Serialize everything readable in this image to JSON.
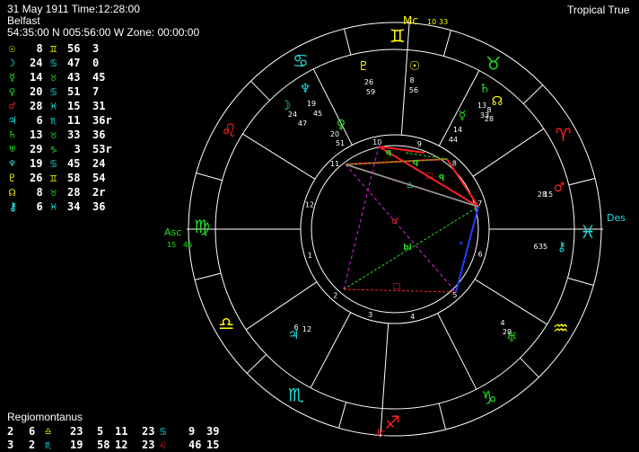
{
  "header": {
    "datetime": "31 May 1911 Time:12:28:00",
    "place": "Belfast",
    "coords": "54:35:00 N 005:56:00 W Zone: 00:00:00",
    "zodiac_mode": "Tropical True"
  },
  "colors": {
    "fire": "#ff2020",
    "earth": "#20e020",
    "air": "#ffff00",
    "water": "#20e0e0",
    "planet": "#ffff00",
    "house_cusp": "#ffffff",
    "asc": "#20e020",
    "mc": "#ffff00",
    "ic": "#ff2020",
    "des": "#20e0e0"
  },
  "planets": [
    {
      "glyph": "☉",
      "color": "#ffff00",
      "deg": "8",
      "sign": "♊",
      "sign_color": "#ffff00",
      "min": "56",
      "sec": "3"
    },
    {
      "glyph": "☽",
      "color": "#20e0e0",
      "deg": "24",
      "sign": "♋",
      "sign_color": "#20e0e0",
      "min": "47",
      "sec": "0"
    },
    {
      "glyph": "☿",
      "color": "#20e020",
      "deg": "14",
      "sign": "♉",
      "sign_color": "#20e020",
      "min": "43",
      "sec": "45"
    },
    {
      "glyph": "♀",
      "color": "#20e020",
      "deg": "20",
      "sign": "♋",
      "sign_color": "#20e0e0",
      "min": "51",
      "sec": "7"
    },
    {
      "glyph": "♂",
      "color": "#ff2020",
      "deg": "28",
      "sign": "♓",
      "sign_color": "#20e0e0",
      "min": "15",
      "sec": "31"
    },
    {
      "glyph": "♃",
      "color": "#20e0e0",
      "deg": "6",
      "sign": "♏",
      "sign_color": "#20e0e0",
      "min": "11",
      "sec": "36r"
    },
    {
      "glyph": "♄",
      "color": "#20e020",
      "deg": "13",
      "sign": "♉",
      "sign_color": "#20e020",
      "min": "33",
      "sec": "36"
    },
    {
      "glyph": "♅",
      "color": "#20e020",
      "deg": "29",
      "sign": "♑",
      "sign_color": "#20e020",
      "min": "3",
      "sec": "53r"
    },
    {
      "glyph": "♆",
      "color": "#20e0e0",
      "deg": "19",
      "sign": "♋",
      "sign_color": "#20e0e0",
      "min": "45",
      "sec": "24"
    },
    {
      "glyph": "♇",
      "color": "#ffff00",
      "deg": "26",
      "sign": "♊",
      "sign_color": "#ffff00",
      "min": "58",
      "sec": "54"
    },
    {
      "glyph": "☊",
      "color": "#ffff00",
      "deg": "8",
      "sign": "♉",
      "sign_color": "#20e020",
      "min": "28",
      "sec": "2r"
    },
    {
      "glyph": "⚷",
      "color": "#20e0e0",
      "deg": "6",
      "sign": "♓",
      "sign_color": "#20e0e0",
      "min": "34",
      "sec": "36"
    }
  ],
  "house_system": "Regiomontanus",
  "houses": [
    [
      {
        "num": "2",
        "deg": "6",
        "sign": "♎",
        "sign_color": "#ffff00",
        "min": "23"
      },
      {
        "num": "5",
        "deg": "11",
        "sign": "",
        "sign_color": "#ffffff",
        "min": "23"
      },
      {
        "num": "",
        "deg": "",
        "sign": "♋",
        "sign_color": "#20e0e0",
        "min": ""
      },
      {
        "num": "9",
        "deg": "",
        "sign": "",
        "sign_color": "#ffffff",
        "min": "39"
      }
    ],
    [
      {
        "num": "3",
        "deg": "2",
        "sign": "♏",
        "sign_color": "#20e0e0",
        "min": "19"
      },
      {
        "num": "58",
        "deg": "12",
        "sign": "",
        "sign_color": "#ffffff",
        "min": "23"
      },
      {
        "num": "",
        "deg": "",
        "sign": "♌",
        "sign_color": "#ff2020",
        "min": ""
      },
      {
        "num": "46",
        "deg": "",
        "sign": "",
        "sign_color": "#ffffff",
        "min": "15"
      }
    ]
  ],
  "wheel": {
    "angles": {
      "asc_label": "Asc",
      "asc_deg": "15",
      "asc_min": "46",
      "mc_label": "Mc",
      "mc_deg": "10",
      "mc_min": "33",
      "des_label": "Des",
      "ic_label": "Ic"
    },
    "signs": [
      {
        "glyph": "♊",
        "color": "#ffff00"
      },
      {
        "glyph": "♉",
        "color": "#20e020"
      },
      {
        "glyph": "♈",
        "color": "#ff2020"
      },
      {
        "glyph": "♓",
        "color": "#20e0e0"
      },
      {
        "glyph": "♒",
        "color": "#ffff00"
      },
      {
        "glyph": "♑",
        "color": "#20e020"
      },
      {
        "glyph": "♐",
        "color": "#ff2020"
      },
      {
        "glyph": "♏",
        "color": "#20e0e0"
      },
      {
        "glyph": "♎",
        "color": "#ffff00"
      },
      {
        "glyph": "♍",
        "color": "#20e020"
      },
      {
        "glyph": "♌",
        "color": "#ff2020"
      },
      {
        "glyph": "♋",
        "color": "#20e0e0"
      }
    ],
    "house_numbers": [
      "1",
      "2",
      "3",
      "4",
      "5",
      "6",
      "7",
      "8",
      "9",
      "10",
      "11",
      "12"
    ],
    "wheel_planets": [
      {
        "glyph": "♇",
        "color": "#ffff00",
        "deg": "26",
        "min": "59"
      },
      {
        "glyph": "☉",
        "color": "#ffff00",
        "deg": "8",
        "min": "56"
      },
      {
        "glyph": "♆",
        "color": "#20e0e0",
        "deg": "19",
        "min": "45"
      },
      {
        "glyph": "☽",
        "color": "#20e0e0",
        "deg": "24",
        "min": "47"
      },
      {
        "glyph": "♀",
        "color": "#20e020",
        "deg": "20",
        "min": "51"
      },
      {
        "glyph": "♄",
        "color": "#20e020",
        "deg": "13",
        "min": "33"
      },
      {
        "glyph": "☊",
        "color": "#ffff00",
        "deg": "8",
        "min": "28"
      },
      {
        "glyph": "☿",
        "color": "#20e020",
        "deg": "14",
        "min": "44"
      },
      {
        "glyph": "♂",
        "color": "#ff2020",
        "deg": "28",
        "min": "15"
      },
      {
        "glyph": "⚷",
        "color": "#20e0e0",
        "deg": "6",
        "min": "35"
      },
      {
        "glyph": "♅",
        "color": "#20e020",
        "deg": "29",
        "min": "4"
      },
      {
        "glyph": "♃",
        "color": "#20e0e0",
        "deg": "6",
        "min": "12"
      }
    ],
    "aspect_glyphs": [
      {
        "glyph": "q",
        "color": "#20e020"
      },
      {
        "glyph": "q",
        "color": "#20e020"
      },
      {
        "glyph": "□",
        "color": "#ff2020"
      },
      {
        "glyph": "△",
        "color": "#20e0e0"
      },
      {
        "glyph": "♂",
        "color": "#ff2020"
      },
      {
        "glyph": "*",
        "color": "#2040ff"
      },
      {
        "glyph": "□",
        "color": "#ff2020"
      },
      {
        "glyph": "bi",
        "color": "#20e020"
      },
      {
        "glyph": "q",
        "color": "#20e020"
      }
    ]
  }
}
